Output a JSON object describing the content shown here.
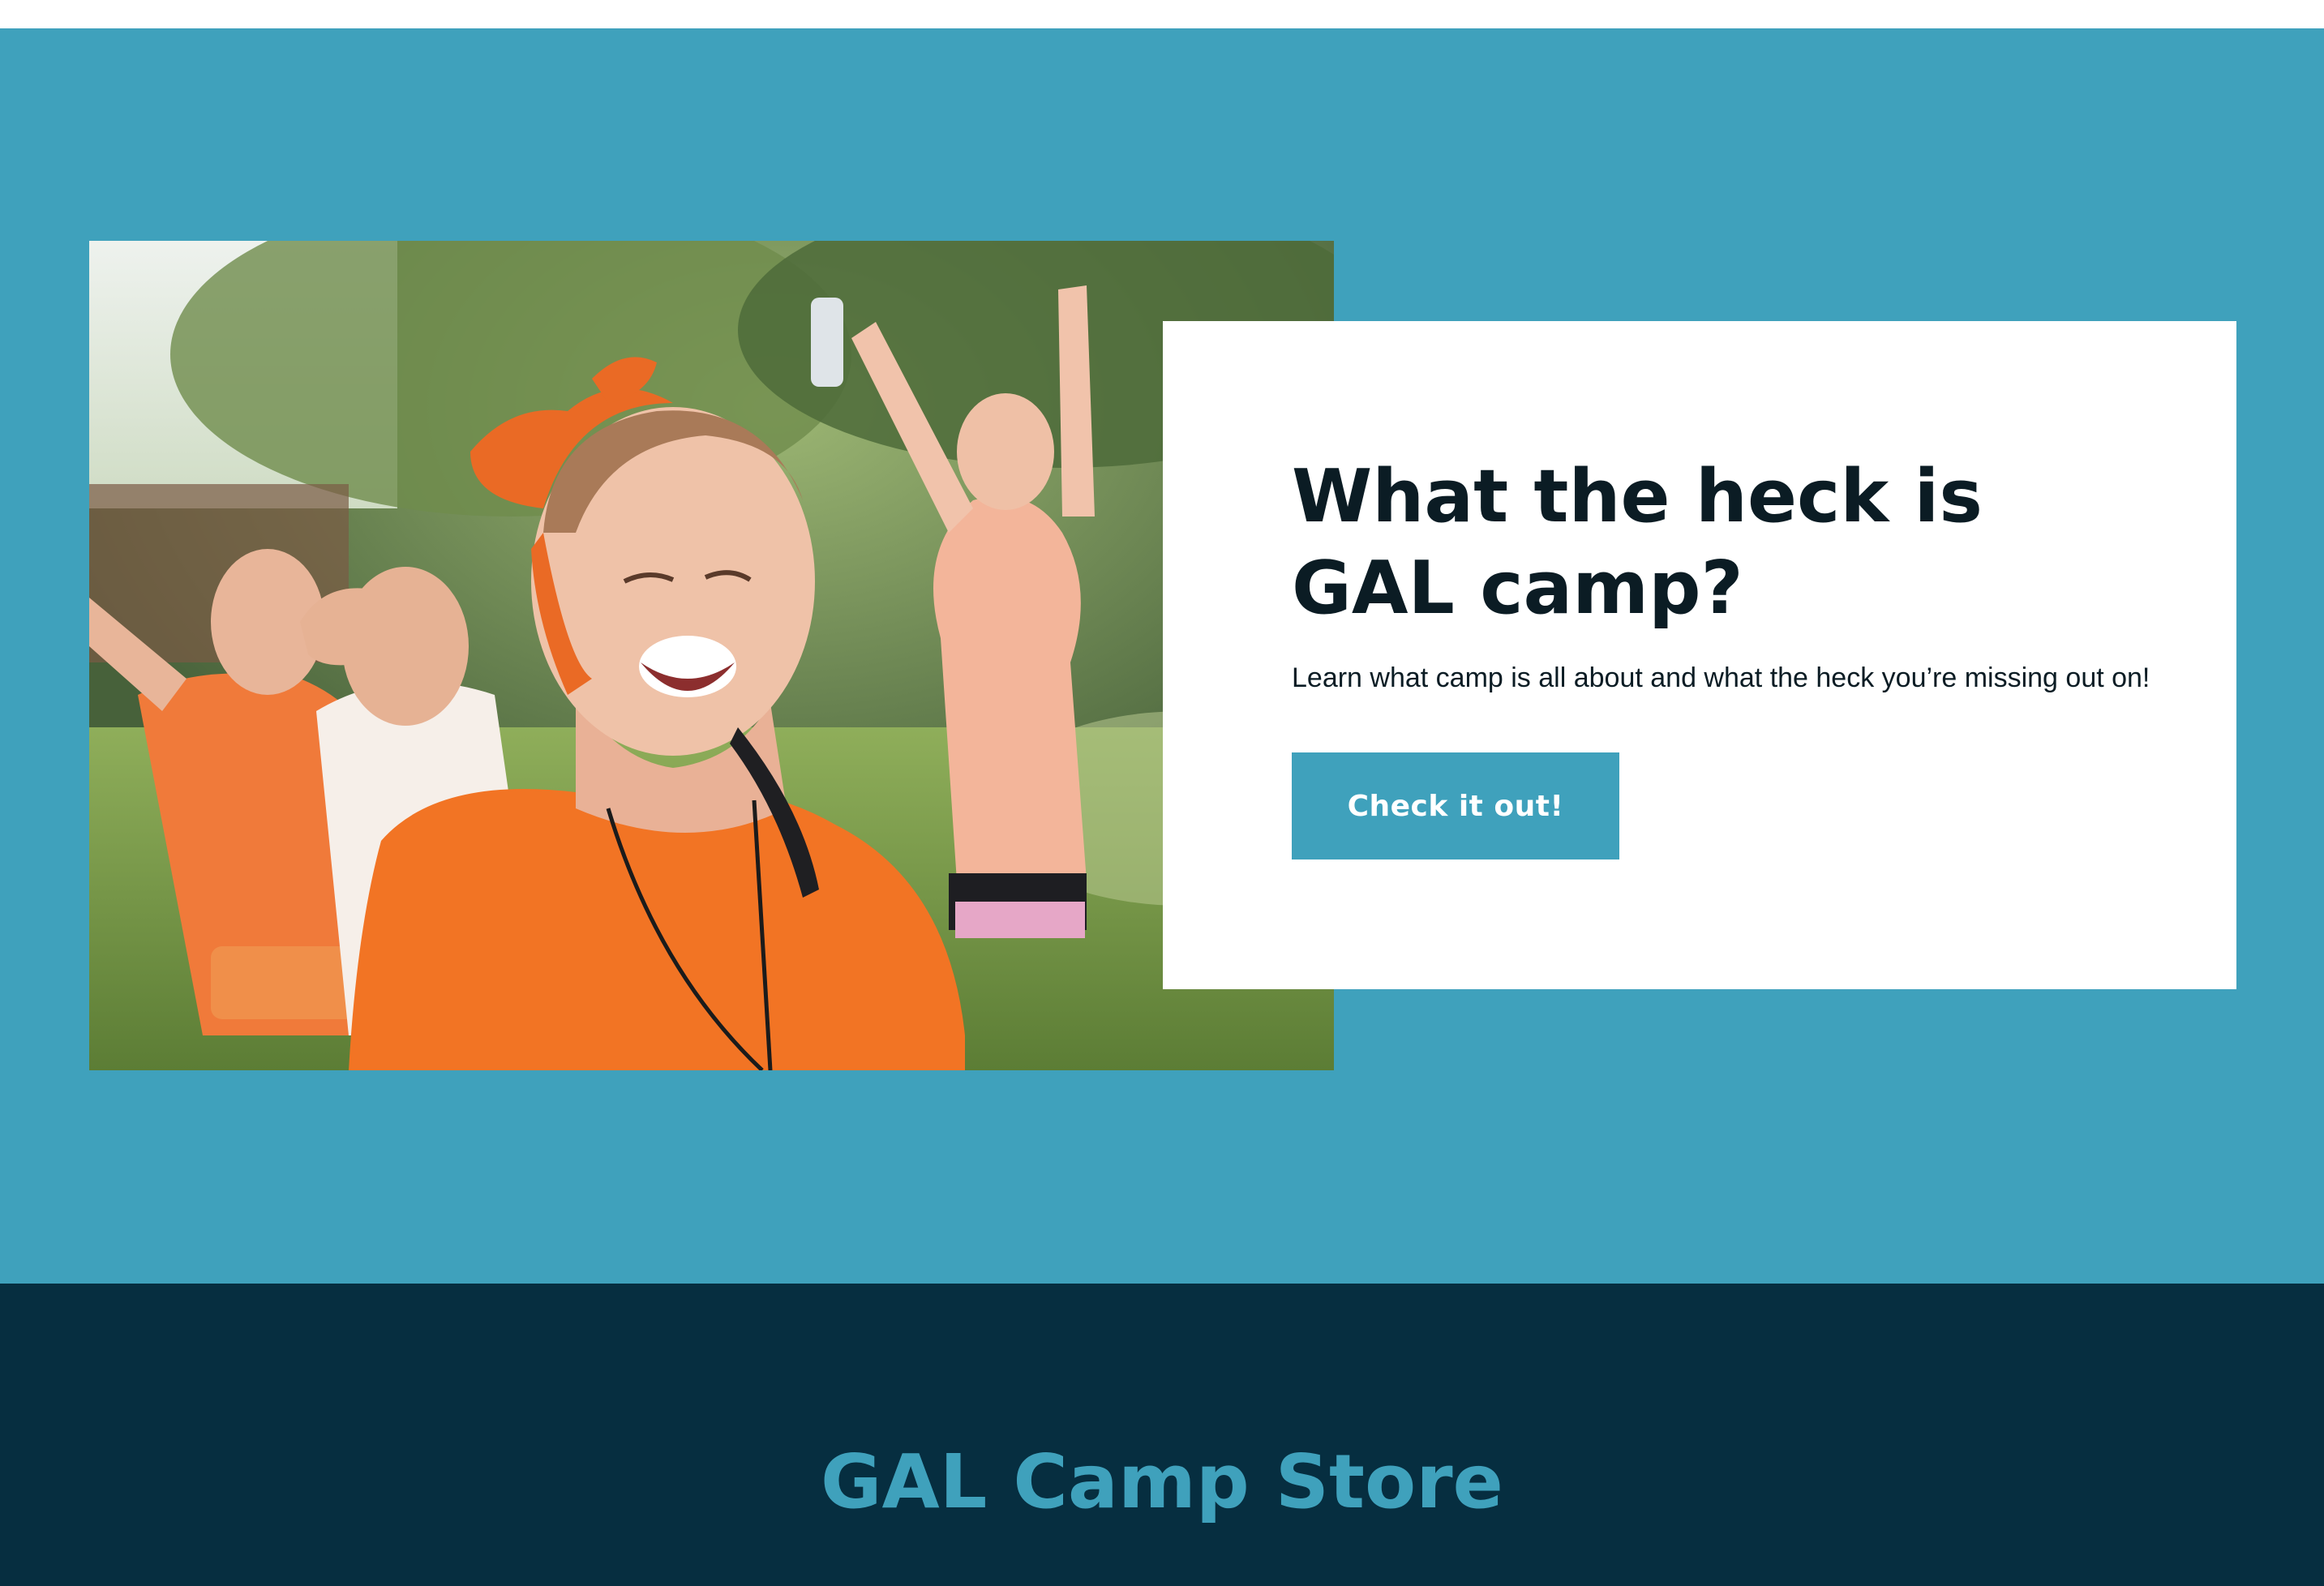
{
  "colors": {
    "hero_background": "#3fa1bc",
    "card_background": "#ffffff",
    "heading_text": "#0b1c24",
    "button_background": "#3fa1bc",
    "button_text": "#ffffff",
    "store_background": "#062e40",
    "store_heading": "#3fa1bc"
  },
  "hero": {
    "photo": {
      "icon": "photo-campers-laughing"
    },
    "card": {
      "title_line1": "What the heck is",
      "title_line2": "GAL camp?",
      "subtitle": "Learn what camp is all about and what the heck you’re missing out on!",
      "button_label": "Check it out!"
    }
  },
  "store": {
    "title": "GAL Camp Store"
  }
}
